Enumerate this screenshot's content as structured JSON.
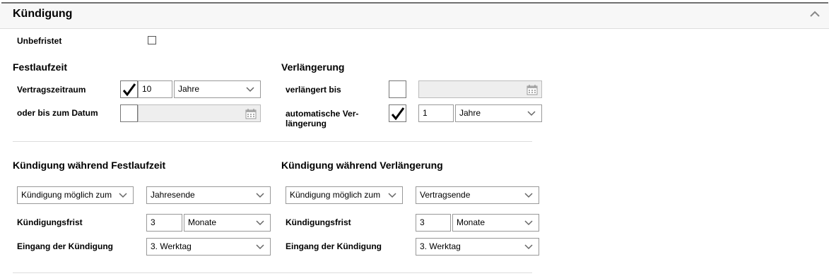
{
  "header": {
    "title": "Kündigung"
  },
  "unbefristet": {
    "label": "Unbefristet"
  },
  "festlaufzeit": {
    "heading": "Festlaufzeit",
    "vertragszeitraum": {
      "label": "Vertragszeitraum",
      "checked": true,
      "value": "10",
      "unit": "Jahre"
    },
    "bis_datum": {
      "label": "oder bis zum Datum",
      "checked": false,
      "value": ""
    }
  },
  "verlaengerung": {
    "heading": "Verlängerung",
    "verlaengert_bis": {
      "label": "verlängert bis",
      "checked": false,
      "value": ""
    },
    "automatisch": {
      "label_line1": "automatische Ver-",
      "label_line2": "längerung",
      "checked": true,
      "value": "1",
      "unit": "Jahre"
    }
  },
  "kuendigung_fest": {
    "heading": "Kündigung während Festlaufzeit",
    "mode": "Kündigung möglich zum",
    "mode_value": "Jahresende",
    "frist_label": "Kündigungsfrist",
    "frist_value": "3",
    "frist_unit": "Monate",
    "eingang_label": "Eingang der Kündigung",
    "eingang_value": "3. Werktag"
  },
  "kuendigung_verl": {
    "heading": "Kündigung während Verlängerung",
    "mode": "Kündigung möglich zum",
    "mode_value": "Vertragsende",
    "frist_label": "Kündigungsfrist",
    "frist_value": "3",
    "frist_unit": "Monate",
    "eingang_label": "Eingang der Kündigung",
    "eingang_value": "3. Werktag"
  }
}
